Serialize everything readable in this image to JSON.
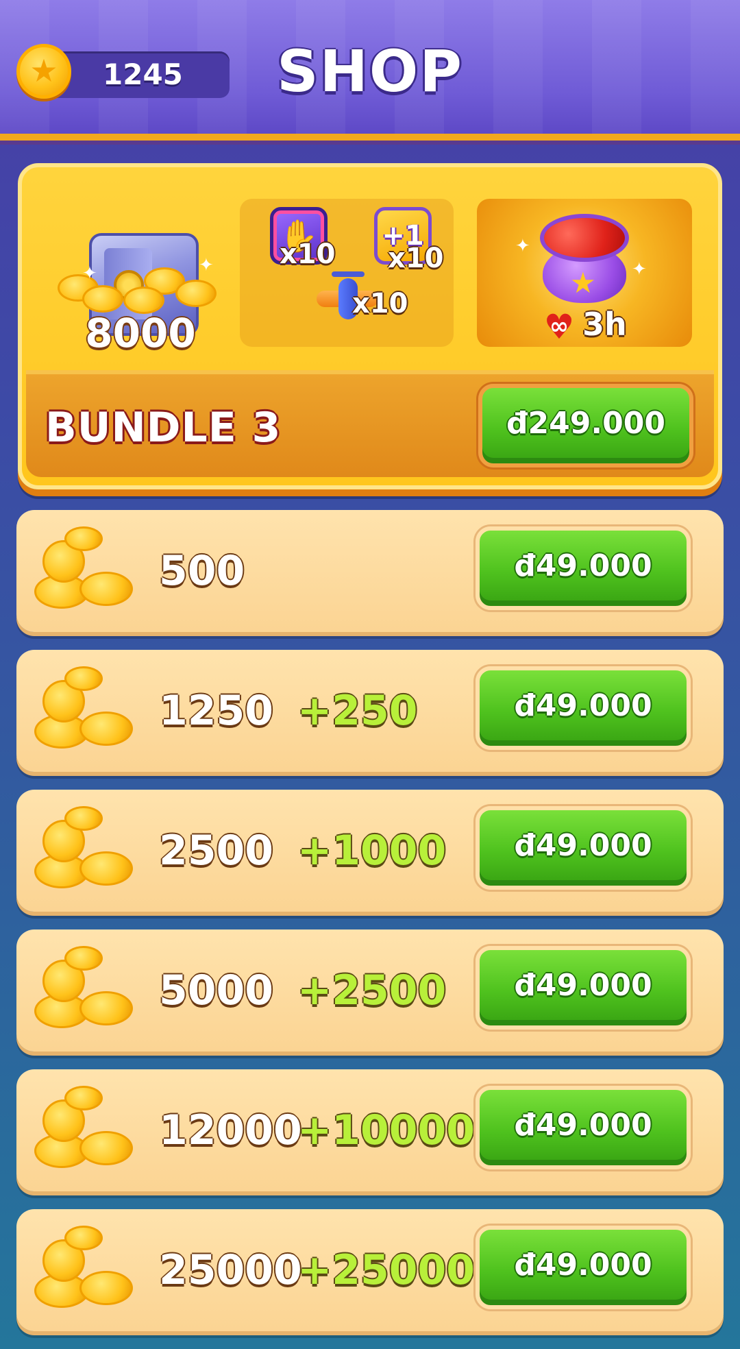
{
  "header": {
    "coin_balance": "1245",
    "title": "SHOP"
  },
  "bundle": {
    "coins": "8000",
    "boosters": [
      {
        "icon": "grab-hand-booster-icon",
        "qty": "x10"
      },
      {
        "icon": "plus-one-booster-icon",
        "label": "+1",
        "qty": "x10"
      },
      {
        "icon": "plane-booster-icon",
        "qty": "x10"
      }
    ],
    "lives": {
      "symbol": "∞",
      "duration": "3h"
    },
    "name": "BUNDLE 3",
    "price": "đ249.000"
  },
  "packs": [
    {
      "amount": "500",
      "bonus": "",
      "price": "đ49.000"
    },
    {
      "amount": "1250",
      "bonus": "+250",
      "price": "đ49.000"
    },
    {
      "amount": "2500",
      "bonus": "+1000",
      "price": "đ49.000"
    },
    {
      "amount": "5000",
      "bonus": "+2500",
      "price": "đ49.000"
    },
    {
      "amount": "12000",
      "bonus": "+10000",
      "price": "đ49.000"
    },
    {
      "amount": "25000",
      "bonus": "+25000",
      "price": "đ49.000"
    }
  ],
  "colors": {
    "header_purple": "#6f5bd6",
    "bundle_gold": "#ffc61d",
    "button_green": "#4fc21e",
    "pack_cream": "#fbd493",
    "bonus_green": "#b8f03a"
  }
}
